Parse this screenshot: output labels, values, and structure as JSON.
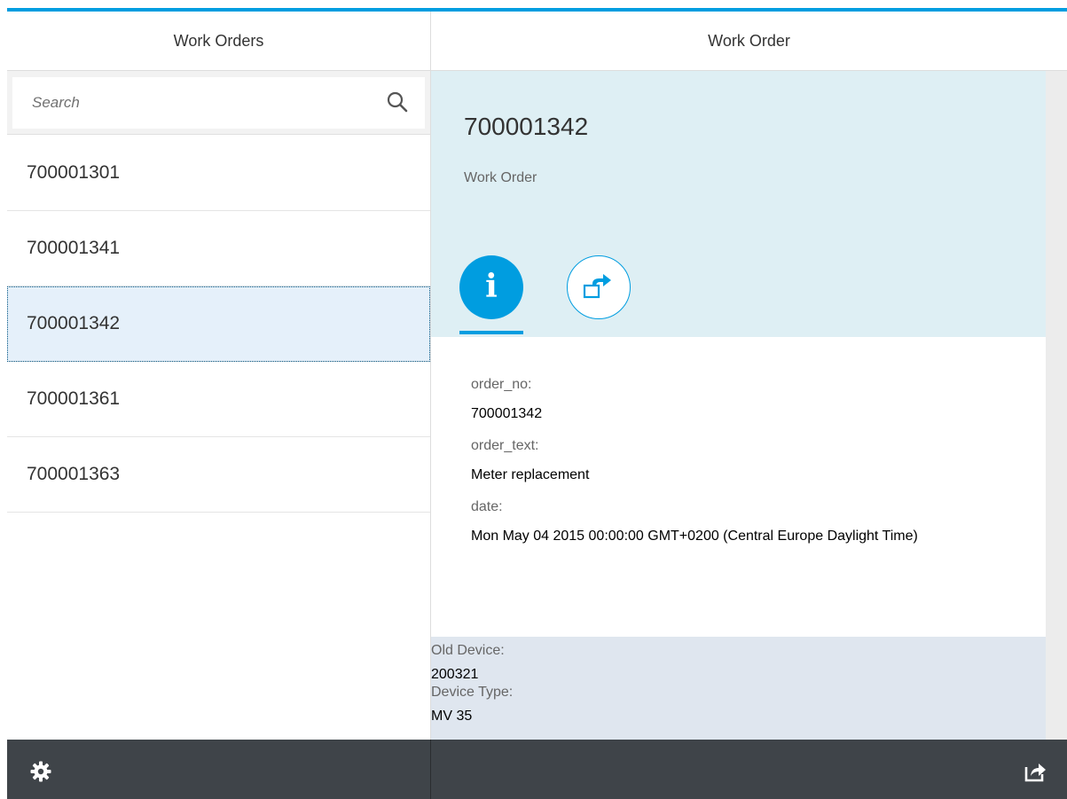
{
  "master": {
    "title": "Work Orders",
    "search": {
      "placeholder": "Search",
      "value": ""
    },
    "items": [
      {
        "label": "700001301"
      },
      {
        "label": "700001341"
      },
      {
        "label": "700001342",
        "selected": true
      },
      {
        "label": "700001361"
      },
      {
        "label": "700001363"
      }
    ]
  },
  "detail": {
    "title": "Work Order",
    "object": {
      "title": "700001342",
      "subtitle": "Work Order"
    },
    "tabs": [
      {
        "icon": "info-icon",
        "glyph": "i",
        "active": true
      },
      {
        "icon": "export-icon",
        "active": false
      }
    ],
    "fields": [
      {
        "label": "order_no:",
        "value": "700001342"
      },
      {
        "label": "order_text:",
        "value": "Meter replacement"
      },
      {
        "label": "date:",
        "value": "Mon May 04 2015 00:00:00 GMT+0200 (Central Europe Daylight Time)"
      }
    ],
    "device": {
      "old_device_label": "Old Device:",
      "old_device_value": "200321",
      "device_type_label": "Device Type:",
      "device_type_value": "MV 35"
    }
  },
  "footer": {
    "left_icon": "gear-icon",
    "right_icon": "share-icon"
  },
  "colors": {
    "accent": "#009de0",
    "footer": "#3f4449",
    "header_bg": "#deeff4",
    "selected_bg": "#e5f0fa",
    "device_bg": "#dfe6ef"
  }
}
